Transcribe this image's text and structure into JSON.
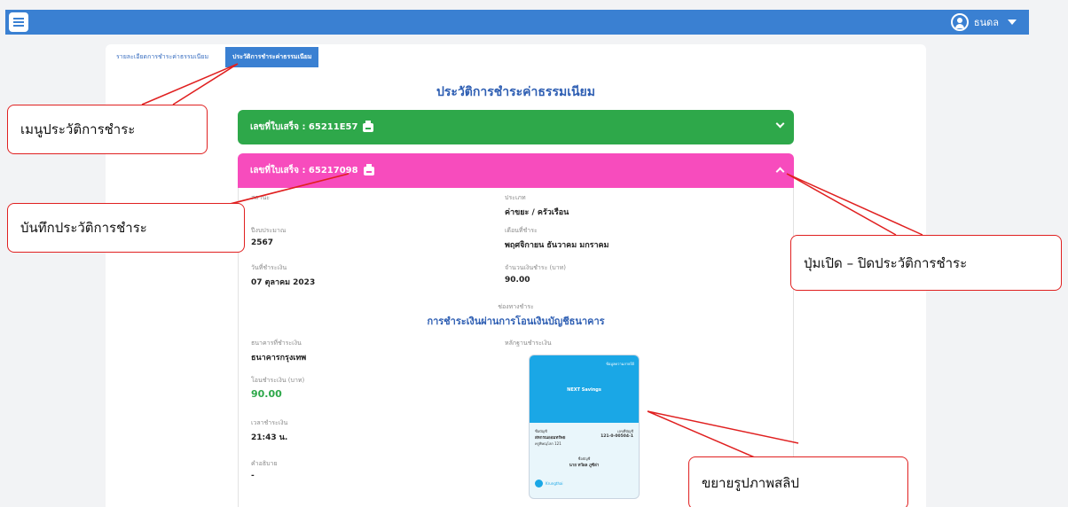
{
  "topbar": {
    "user_name": "ธนดล"
  },
  "tabs": [
    {
      "label": "รายละเอียดการชำระค่าธรรมเนียม"
    },
    {
      "label": "ประวัติการชำระค่าธรรมเนียม"
    }
  ],
  "page_title": "ประวัติการชำระค่าธรรมเนียม",
  "receipts": [
    {
      "label": "เลขที่ใบเสร็จ : 65211E57",
      "color": "#2ea84a",
      "state": "collapsed"
    },
    {
      "label": "เลขที่ใบเสร็จ : 65217098",
      "color": "#f74cbd",
      "state": "expanded"
    }
  ],
  "detail": {
    "status_label": "สถานะ",
    "type_label": "ประเภท",
    "type_value": "ค่าขยะ / ครัวเรือน",
    "budget_year_label": "ปีงบประมาณ",
    "budget_year_value": "2567",
    "months_label": "เดือนที่ชำระ",
    "months_value": "พฤศจิกายน ธันวาคม มกราคม",
    "pay_date_label": "วันที่ชำระเงิน",
    "pay_date_value": "07 ตุลาคม 2023",
    "amount_label": "จำนวนเงินชำระ (บาท)",
    "amount_value": "90.00",
    "channel_label": "ช่องทางชำระ",
    "channel_value": "การชำระเงินผ่านการโอนเงินบัญชีธนาคาร",
    "bank_label": "ธนาคารที่ชำระเงิน",
    "bank_value": "ธนาคารกรุงเทพ",
    "transfer_label": "โอนชำระเงิน (บาท)",
    "transfer_value": "90.00",
    "time_label": "เวลาชำระเงิน",
    "time_value": "21:43 น.",
    "desc_label": "คำอธิบาย",
    "desc_value": "-",
    "evidence_label": "หลักฐานชำระเงิน"
  },
  "slip": {
    "tag": "ข้อมูลความภายใต้",
    "savings": "NEXT Savings",
    "from_label": "ชื่อบัญชี",
    "from_name": "สหกรณออมทรัพย",
    "from_sub": "ครูพิษณุโลก 121",
    "acct_label": "เลขที่บัญชี",
    "acct_no": "121-0-00504-1",
    "owner_label": "ชื่อบัญชี",
    "owner_name": "นาย ทวีผล ภูซีล่า",
    "bank_name": "Krungthai"
  },
  "callouts": {
    "menu": "เมนูประวัติการชำระ",
    "record": "บันทึกประวัติการชำระ",
    "toggle": "ปุ่มเปิด – ปิดประวัติการชำระ",
    "zoom": "ขยายรูปภาพสลิป"
  },
  "colors": {
    "primary": "#3a80d2",
    "success": "#2ea84a",
    "pink": "#f74cbd",
    "callout_border": "#e02020"
  }
}
